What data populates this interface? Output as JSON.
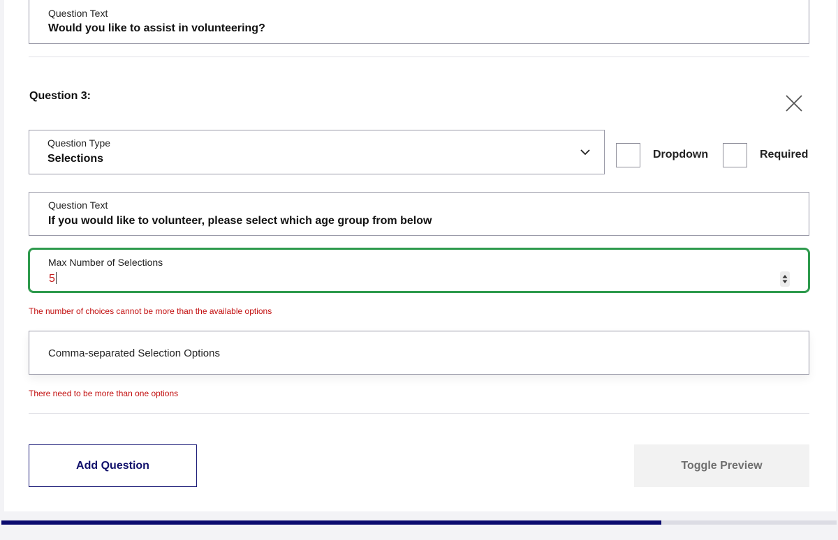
{
  "question2": {
    "text_label": "Question Text",
    "text_value": "Would you like to assist in volunteering?"
  },
  "question3": {
    "heading": "Question 3:",
    "type_label": "Question Type",
    "type_value": "Selections",
    "dropdown_label": "Dropdown",
    "required_label": "Required",
    "text_label": "Question Text",
    "text_value": "If you would like to volunteer, please select which age group from below",
    "max_label": "Max Number of Selections",
    "max_value": "5",
    "max_error": "The number of choices cannot be more than the available options",
    "options_placeholder": "Comma-separated Selection Options",
    "options_error": "There need to be more than one options"
  },
  "actions": {
    "add_question": "Add Question",
    "toggle_preview": "Toggle Preview"
  },
  "progress": {
    "fraction": 0.79
  },
  "icons": {
    "close": "close-icon",
    "chevron": "chevron-down-icon",
    "spinner": "number-spinner-icon"
  },
  "colors": {
    "accent_navy": "#0a0a6e",
    "error_red": "#c20e0e",
    "focus_green": "#2e9a4d"
  }
}
